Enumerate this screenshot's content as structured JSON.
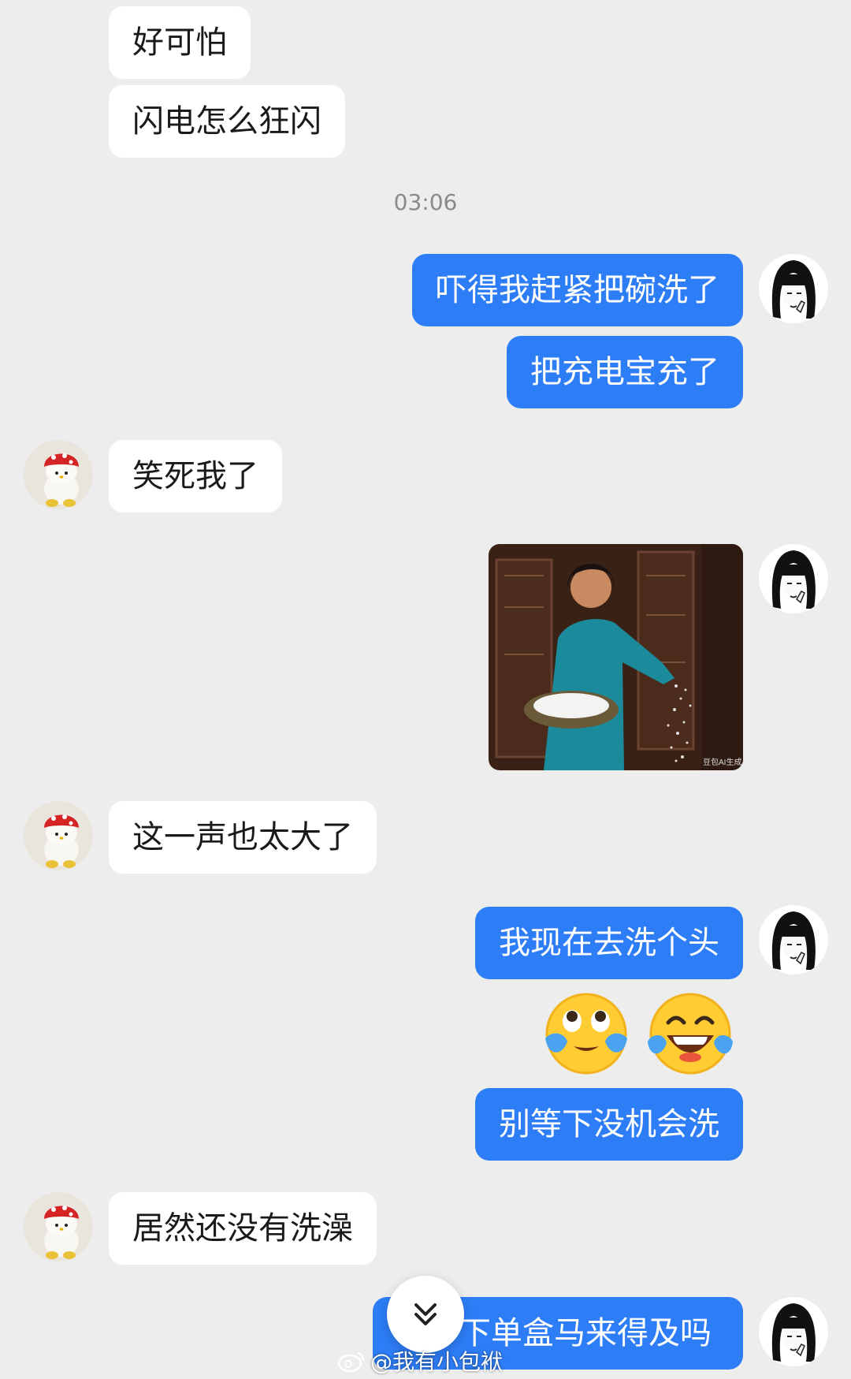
{
  "colors": {
    "incoming_bg": "#ffffff",
    "outgoing_bg": "#2d7df6",
    "background": "#ededee"
  },
  "timestamp": "03:06",
  "messages": [
    {
      "side": "in",
      "text": "好可怕"
    },
    {
      "side": "in",
      "text": "闪电怎么狂闪"
    },
    {
      "side": "out",
      "text": "吓得我赶紧把碗洗了"
    },
    {
      "side": "out",
      "text": "把充电宝充了"
    },
    {
      "side": "in",
      "text": "笑死我了"
    },
    {
      "side": "out",
      "type": "image",
      "caption": "豆包AI生成"
    },
    {
      "side": "in",
      "text": "这一声也太大了"
    },
    {
      "side": "out",
      "text": "我现在去洗个头"
    },
    {
      "side": "out",
      "type": "emoji",
      "icons": [
        "crying-laughing-face-icon",
        "laughing-tears-face-icon"
      ]
    },
    {
      "side": "out",
      "text": "别等下没机会洗"
    },
    {
      "side": "in",
      "text": "居然还没有洗澡"
    },
    {
      "side": "out",
      "text": "下单盒马来得及吗"
    }
  ],
  "watermark": "@我有小包袱"
}
